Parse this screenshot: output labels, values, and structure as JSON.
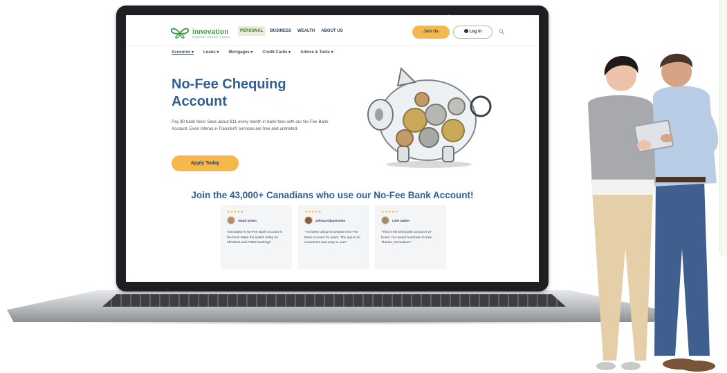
{
  "site": {
    "logo_name": "innovation",
    "logo_sub": "FEDERAL CREDIT UNION",
    "top_nav": [
      "PERSONAL",
      "BUSINESS",
      "WEALTH",
      "ABOUT US"
    ],
    "join_label": "Join Us",
    "login_label": "Log In",
    "sub_nav": [
      "Accounts",
      "Loans",
      "Mortgages",
      "Credit Cards",
      "Advice & Tools"
    ]
  },
  "hero": {
    "title": "No-Fee Chequing Account",
    "text": "Pay $0 bank fees! Save about $11 every month in bank fees with our No-Fee Bank Account. Even Interac e-Transfer® services are free and unlimited.",
    "cta": "Apply Today"
  },
  "social_proof": {
    "heading": "Join the 43,000+ Canadians who use our No-Fee Bank Account!",
    "reviews": [
      {
        "stars": "★★★★★",
        "name": "Steph Green",
        "text": "\"Innovation's No-Fee Bank Account is the best! Make the switch today for effortless and FREE banking!\""
      },
      {
        "stars": "★★★★★",
        "name": "Jelissa Klippenstein",
        "text": "\"I've been using Innovation's No-Fee Bank Account for years. The app is so convenient and easy to use!\""
      },
      {
        "stars": "★★★★★",
        "name": "Lelle Sather",
        "text": "\"This is the best bank account I've found. I've saved hundreds in fees. Thanks, Innovation!\""
      }
    ]
  },
  "colors": {
    "brand_green": "#3f9b46",
    "heading_blue": "#2f5f94",
    "cta_orange": "#f7b84b"
  },
  "icons": [
    "butterfly-logo-icon",
    "user-icon",
    "search-icon",
    "chevron-down-icon",
    "star-icon",
    "piggy-bank-image"
  ]
}
